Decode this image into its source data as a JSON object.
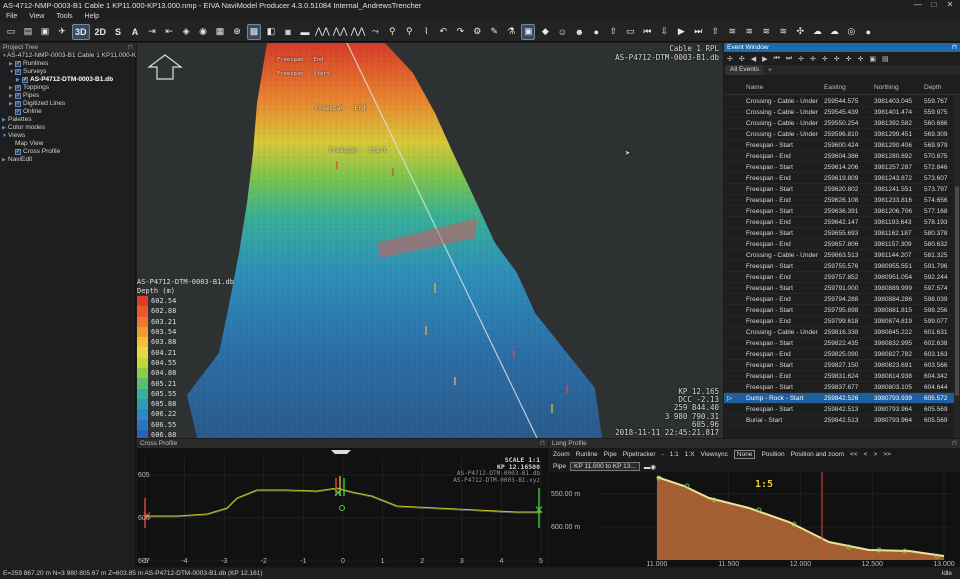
{
  "window": {
    "title": "AS-4712-NMP-0003-B1 Cable 1 KP11.000-KP13.000.nmp - EIVA NaviModel Producer 4.3.0.51084 Internal_AndrewsTrencher",
    "minimize": "—",
    "maximize": "□",
    "close": "✕"
  },
  "menu": [
    "File",
    "View",
    "Tools",
    "Help"
  ],
  "toolbar": {
    "view_3d": "3D",
    "view_2d": "2D",
    "view_s": "S",
    "view_a": "A"
  },
  "project_tree": {
    "header": "Project Tree",
    "items": [
      {
        "label": "AS-4712-NMP-0003-B1 Cable 1 KP11.000-KP13.0...",
        "level": 0,
        "arrow": "▼",
        "checkbox": false
      },
      {
        "label": "Runlines",
        "level": 1,
        "arrow": "▶",
        "checkbox": true
      },
      {
        "label": "Surveys",
        "level": 1,
        "arrow": "▼",
        "checkbox": true
      },
      {
        "label": "AS-P4712-DTM-0003-B1.db",
        "level": 2,
        "arrow": "▶",
        "checkbox": true,
        "selected": true
      },
      {
        "label": "Toppings",
        "level": 1,
        "arrow": "▶",
        "checkbox": true
      },
      {
        "label": "Pipes",
        "level": 1,
        "arrow": "▶",
        "checkbox": true
      },
      {
        "label": "Digitized Lines",
        "level": 1,
        "arrow": "▶",
        "checkbox": true
      },
      {
        "label": "Online",
        "level": 1,
        "arrow": "",
        "checkbox": true
      },
      {
        "label": "Palettes",
        "level": 0,
        "arrow": "▶",
        "checkbox": false
      },
      {
        "label": "Color modes",
        "level": 0,
        "arrow": "▶",
        "checkbox": false
      },
      {
        "label": "Views",
        "level": 0,
        "arrow": "▼",
        "checkbox": false
      },
      {
        "label": "Map View",
        "level": 1,
        "arrow": "",
        "checkbox": false
      },
      {
        "label": "Cross Profile",
        "level": 1,
        "arrow": "",
        "checkbox": true
      },
      {
        "label": "NaviEdit",
        "level": 0,
        "arrow": "▶",
        "checkbox": false
      }
    ]
  },
  "view3d": {
    "top_right_1": "Cable 1 RPL",
    "top_right_2": "AS-P4712-DTM-0003-B1.db",
    "labels": {
      "freespan_end_1": "Freespan - End",
      "freespan_start_1": "Freespan - Start",
      "freespan_end_2": "Freespan - End",
      "freespan_start_2": "Freespan - Start"
    },
    "legend": {
      "source": "AS-P4712-DTM-0003-B1.db",
      "title": "Depth (m)",
      "entries": [
        {
          "value": "602.54",
          "color": "#e23a2a"
        },
        {
          "value": "602.88",
          "color": "#e85a2c"
        },
        {
          "value": "603.21",
          "color": "#ee7a30"
        },
        {
          "value": "603.54",
          "color": "#f29a34"
        },
        {
          "value": "603.88",
          "color": "#f4be3a"
        },
        {
          "value": "604.21",
          "color": "#e8d83e"
        },
        {
          "value": "604.55",
          "color": "#c2d83e"
        },
        {
          "value": "604.88",
          "color": "#8ccc48"
        },
        {
          "value": "605.21",
          "color": "#54c070"
        },
        {
          "value": "605.55",
          "color": "#36b098"
        },
        {
          "value": "605.88",
          "color": "#2e9cb8"
        },
        {
          "value": "606.22",
          "color": "#2d88c4"
        },
        {
          "value": "606.55",
          "color": "#2c74c6"
        },
        {
          "value": "606.88",
          "color": "#2b62c0"
        },
        {
          "value": "607.22",
          "color": "#2a50b6"
        }
      ]
    },
    "readout": {
      "kp": "KP 12.165",
      "dcc": "DCC -2.13",
      "coords": "259 844.40",
      "northing": "3 980 790.31",
      "depth": "605.96",
      "timestamp": "2018-11-11 22:45:21.817"
    }
  },
  "event_window": {
    "header": "Event Window",
    "tab": "All Events",
    "tab_add": "+",
    "columns": [
      "",
      "Name",
      "Easting",
      "Northing",
      "Depth"
    ],
    "rows": [
      [
        "",
        "Crossing - Cable - Under",
        "259544.575",
        "3981403.045",
        "559.767"
      ],
      [
        "",
        "Crossing - Cable - Under",
        "259545.439",
        "3981401.474",
        "559.975"
      ],
      [
        "",
        "Crossing - Cable - Under",
        "259550.254",
        "3981392.582",
        "560.686"
      ],
      [
        "",
        "Crossing - Cable - Under",
        "259596.810",
        "3981299.451",
        "569.309"
      ],
      [
        "",
        "Freespan - Start",
        "259600.424",
        "3981290.406",
        "569.979"
      ],
      [
        "",
        "Freespan - End",
        "259604.386",
        "3981280.692",
        "570.875"
      ],
      [
        "",
        "Freespan - Start",
        "259614.206",
        "3981257.287",
        "572.846"
      ],
      [
        "",
        "Freespan - End",
        "259619.809",
        "3981243.872",
        "573.607"
      ],
      [
        "",
        "Freespan - Start",
        "259620.802",
        "3981241.551",
        "573.797"
      ],
      [
        "",
        "Freespan - End",
        "259626.108",
        "3981233.816",
        "574.656"
      ],
      [
        "",
        "Freespan - Start",
        "259636.391",
        "3981206.706",
        "577.168"
      ],
      [
        "",
        "Freespan - End",
        "259642.147",
        "3981193.643",
        "578.193"
      ],
      [
        "",
        "Freespan - Start",
        "259655.693",
        "3981162.187",
        "580.378"
      ],
      [
        "",
        "Freespan - End",
        "259657.806",
        "3981157.309",
        "580.632"
      ],
      [
        "",
        "Crossing - Cable - Under",
        "259663.513",
        "3981144.207",
        "581.325"
      ],
      [
        "",
        "Freespan - Start",
        "259755.576",
        "3980955.551",
        "591.796"
      ],
      [
        "",
        "Freespan - End",
        "259757.852",
        "3980951.054",
        "592.244"
      ],
      [
        "",
        "Freespan - Start",
        "259791.000",
        "3980889.999",
        "597.574"
      ],
      [
        "",
        "Freespan - End",
        "259794.288",
        "3980884.286",
        "598.039"
      ],
      [
        "",
        "Freespan - Start",
        "259795.698",
        "3980881.815",
        "598.256"
      ],
      [
        "",
        "Freespan - End",
        "259799.618",
        "3980874.819",
        "599.077"
      ],
      [
        "",
        "Crossing - Cable - Under",
        "259816.338",
        "3980845.222",
        "601.631"
      ],
      [
        "",
        "Freespan - Start",
        "259822.435",
        "3980832.995",
        "602.638"
      ],
      [
        "",
        "Freespan - End",
        "259825.090",
        "3980827.782",
        "603.163"
      ],
      [
        "",
        "Freespan - Start",
        "259827.150",
        "3980823.691",
        "603.566"
      ],
      [
        "",
        "Freespan - End",
        "259831.624",
        "3980814.938",
        "604.342"
      ],
      [
        "",
        "Freespan - Start",
        "259837.677",
        "3980803.105",
        "604.644"
      ],
      [
        "▷",
        "Dump - Rock - Start",
        "259842.526",
        "3980793.939",
        "605.572"
      ],
      [
        "",
        "Freespan - Start",
        "259842.513",
        "3980793.964",
        "605.569"
      ],
      [
        "",
        "Burial - Start",
        "259842.513",
        "3980793.964",
        "605.569"
      ]
    ],
    "selected_row": 27
  },
  "cross_profile": {
    "header": "Cross Profile",
    "scale": "SCALE 1:1",
    "kp": "KP 12.16500",
    "src1": "AS-P4712-DTM-0003-B1.db",
    "src2": "AS-P4712-DTM-0003-B1.xyz",
    "y_ticks": [
      "605",
      "606",
      "607"
    ],
    "x_ticks": [
      "-5",
      "-4",
      "-3",
      "-2",
      "-1",
      "0",
      "1",
      "2",
      "3",
      "4",
      "5"
    ]
  },
  "long_profile": {
    "header": "Long Profile",
    "tools": [
      "Zoom",
      "Runline",
      "Pipe",
      "Pipetracker",
      "-",
      "1:1",
      "1:X",
      "Viewsync",
      "None",
      "Position",
      "Position and zoom",
      "<<",
      "<",
      ">",
      ">>"
    ],
    "selected_tool": "None",
    "pipe_label": "Pipe",
    "pipe_value": "KP 11.000 to KP 13...",
    "ratio": "1:5",
    "y_ticks": [
      "550.00 m",
      "600.00 m"
    ],
    "x_ticks": [
      "11.000",
      "11.500",
      "12.000",
      "12.500",
      "13.000"
    ]
  },
  "status": {
    "text": "E=259 867.20 m N=3 980 805.67 m Z=603.85 m AS-P4712-DTM-0003-B1.db (KP 12.161)",
    "state": "Idle"
  }
}
